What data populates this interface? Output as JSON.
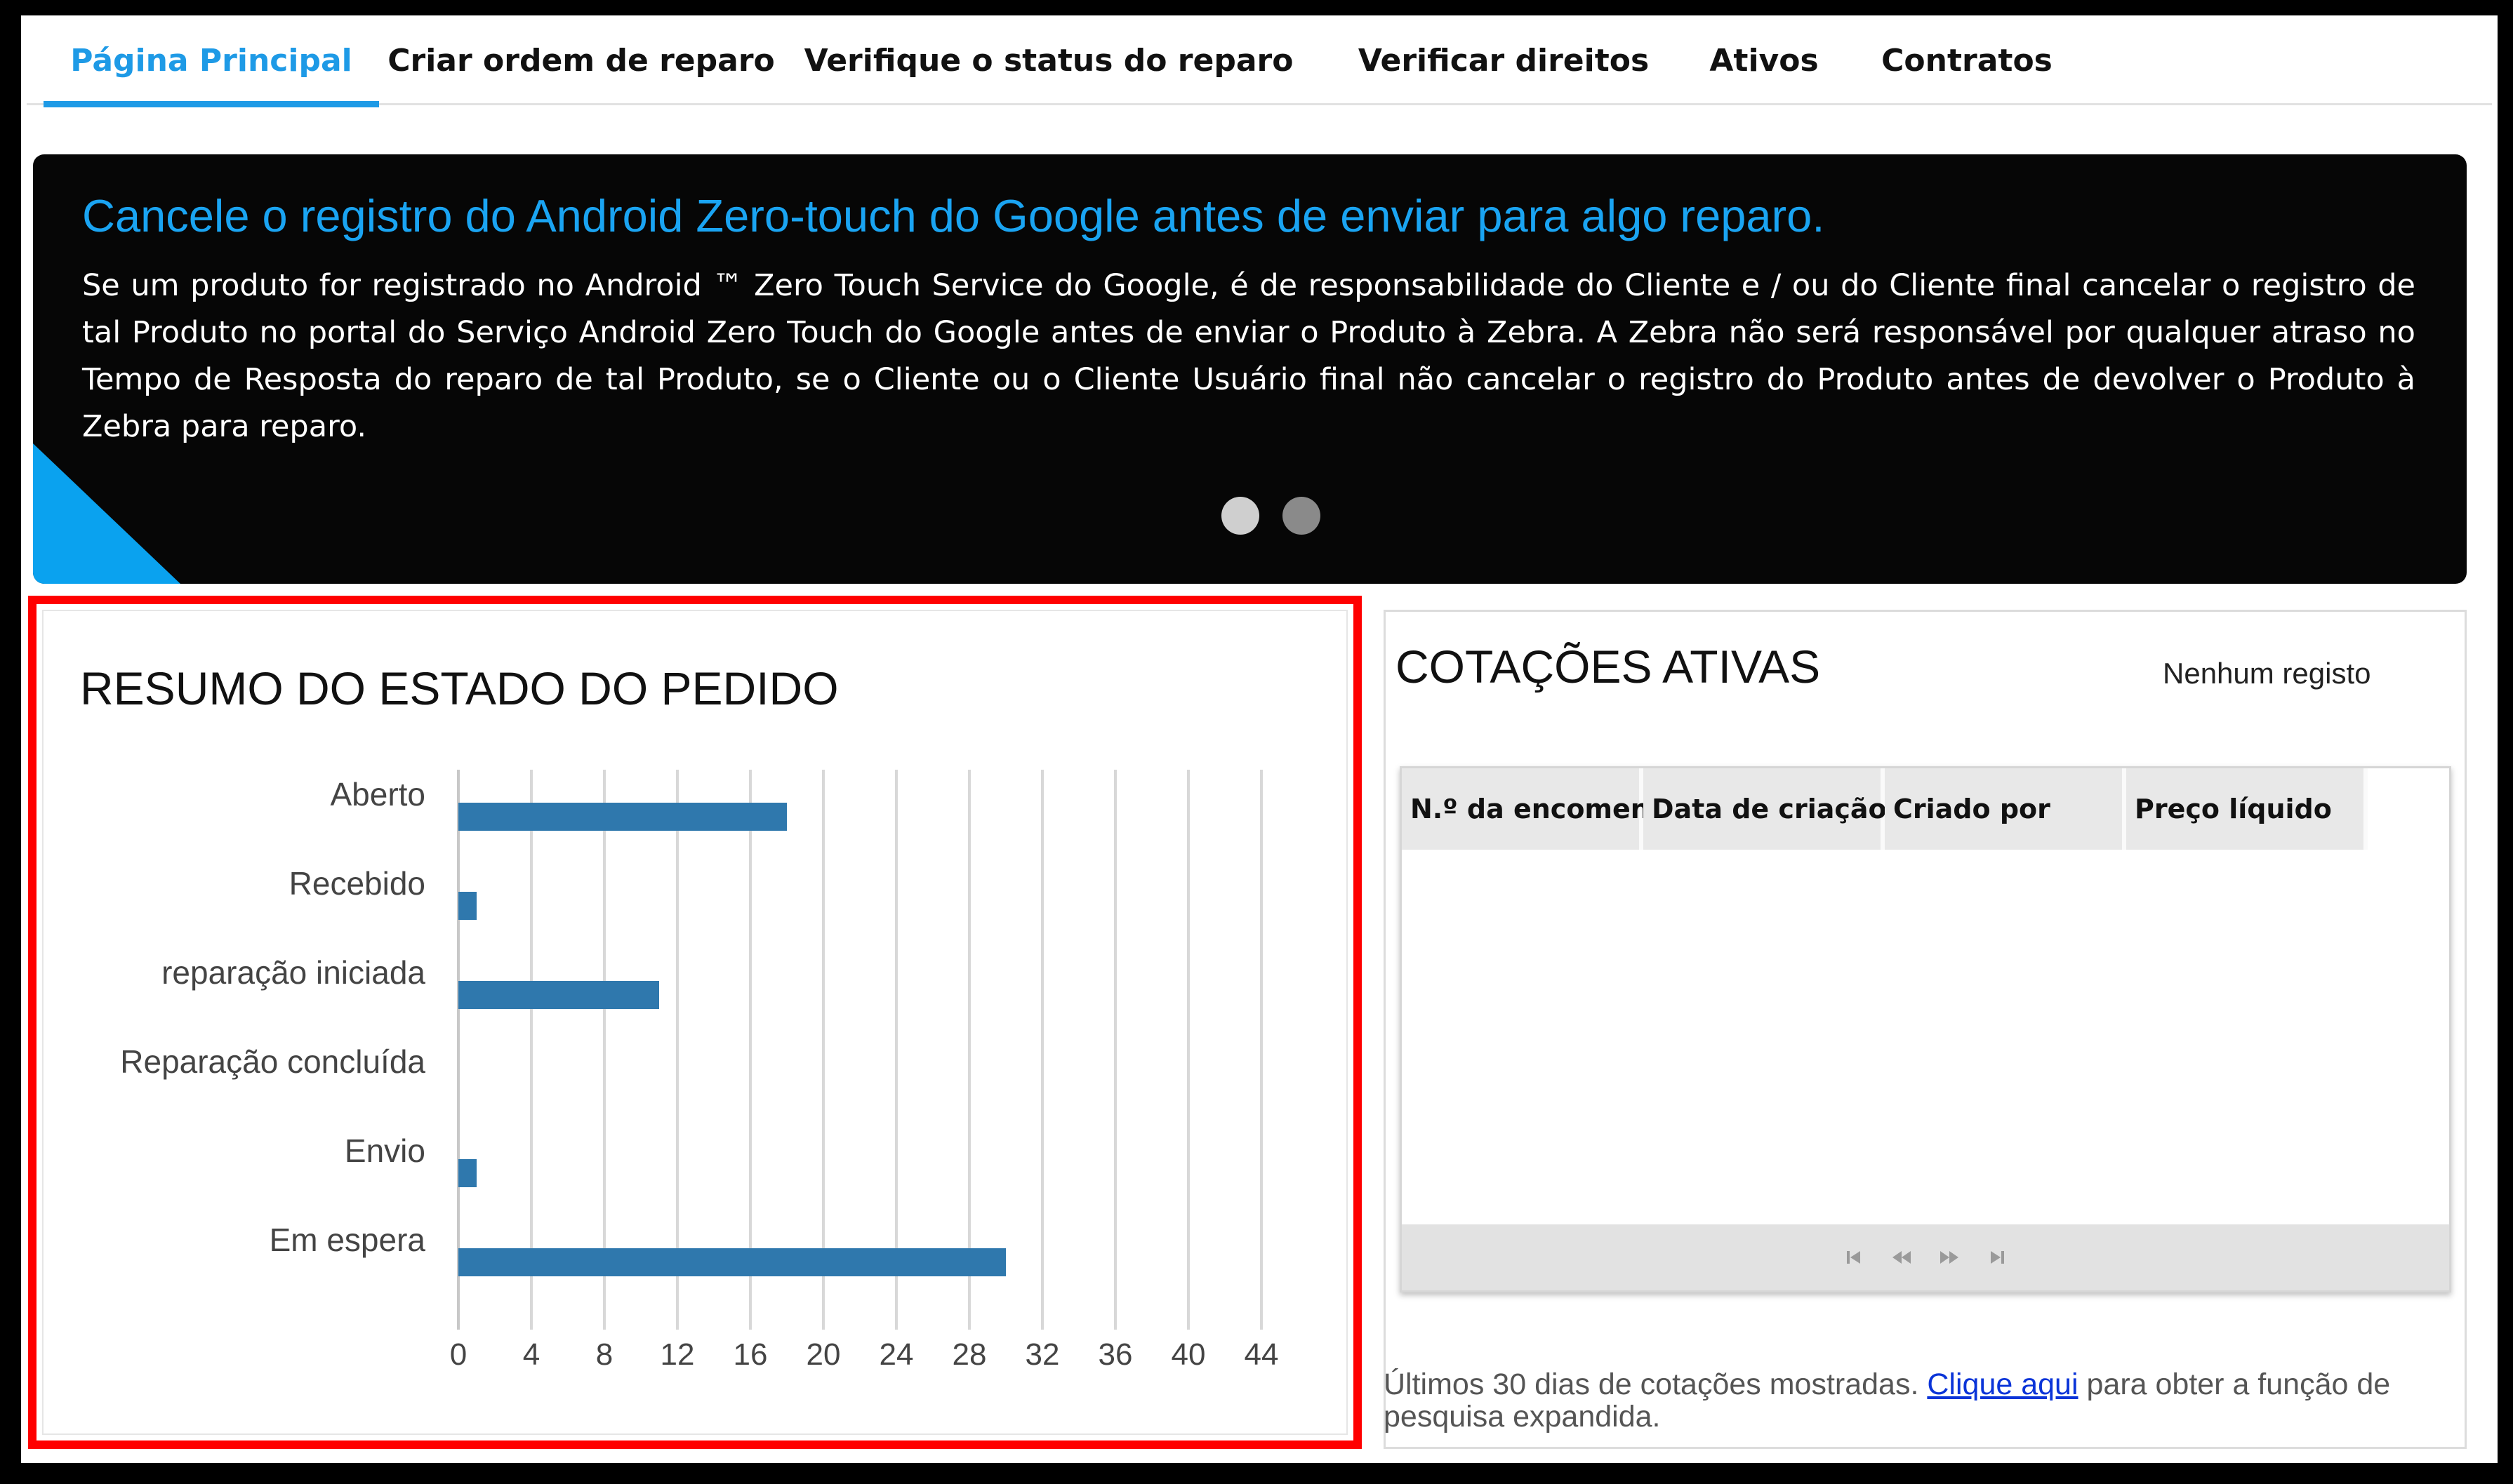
{
  "nav": {
    "tabs": [
      {
        "label": "Página Principal",
        "active": true
      },
      {
        "label": "Criar ordem de reparo",
        "active": false
      },
      {
        "label": "Verifique o status do reparo",
        "active": false
      },
      {
        "label": "Verificar direitos",
        "active": false
      },
      {
        "label": "Ativos",
        "active": false
      },
      {
        "label": "Contratos",
        "active": false
      }
    ]
  },
  "banner": {
    "title": "Cancele o registro do Android Zero-touch do Google antes de enviar para algo reparo.",
    "body": "Se um produto for registrado no Android ™ Zero Touch Service do Google, é de responsabilidade do Cliente e / ou do Cliente final cancelar o registro de tal Produto no portal do Serviço Android Zero Touch do Google antes de enviar o Produto à Zebra. A Zebra não será responsável por qualquer atraso no Tempo de Resposta do reparo de tal Produto, se o Cliente ou o Cliente Usuário final não cancelar o registro do Produto antes de devolver o Produto à Zebra para reparo.",
    "slide_count": 2,
    "active_slide": 1
  },
  "order_summary": {
    "title": "RESUMO DO ESTADO DO PEDIDO"
  },
  "chart_data": {
    "type": "bar",
    "orientation": "horizontal",
    "title": "RESUMO DO ESTADO DO PEDIDO",
    "categories": [
      "Aberto",
      "Recebido",
      "reparação iniciada",
      "Reparação concluída",
      "Envio",
      "Em espera"
    ],
    "values": [
      18,
      1,
      11,
      0,
      1,
      30
    ],
    "xlim": [
      0,
      44
    ],
    "xticks": [
      0,
      4,
      8,
      12,
      16,
      20,
      24,
      28,
      32,
      36,
      40,
      44
    ],
    "grid": true,
    "bar_color": "#2f78ad",
    "grid_color": "#d8d8d8"
  },
  "quotes": {
    "title": "COTAÇÕES ATIVAS",
    "empty_message": "Nenhum registo",
    "columns": [
      "N.º da encomenda",
      "Data de criação",
      "Criado por",
      "Preço líquido"
    ],
    "rows": [],
    "pager": {
      "first_icon": "first-page-icon",
      "prev_icon": "previous-page-icon",
      "next_icon": "next-page-icon",
      "last_icon": "last-page-icon"
    },
    "footnote_prefix": "Últimos 30 dias de cotações mostradas.",
    "footnote_link": "Clique aqui",
    "footnote_suffix": "para obter a função de pesquisa expandida."
  },
  "colors": {
    "accent": "#1e9ae6",
    "banner_title": "#1aa4f2",
    "highlight_border": "#ff0000",
    "link": "#0a34d8"
  }
}
